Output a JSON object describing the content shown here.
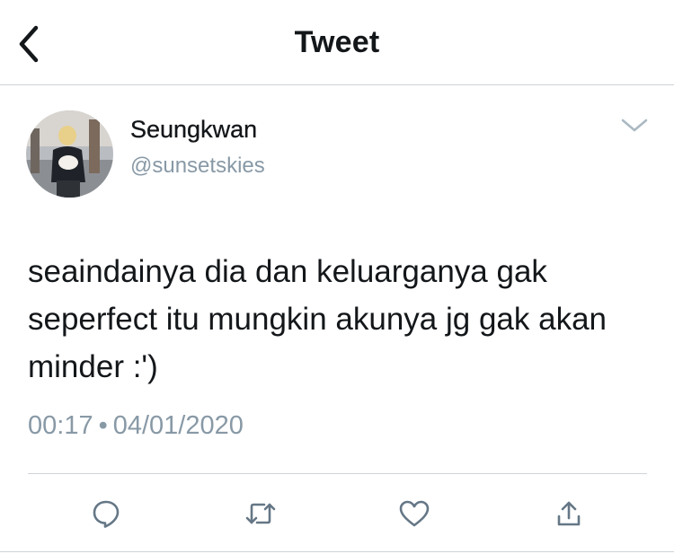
{
  "header": {
    "title": "Tweet",
    "back_icon": "chevron-left-icon"
  },
  "author": {
    "name": "Seungkwan",
    "handle": "@sunsetskies",
    "avatar_icon": "profile-photo"
  },
  "tweet": {
    "text": "seaindainya dia dan keluarganya gak seperfect itu mungkin akunya jg gak akan minder :')",
    "time": "00:17",
    "separator": "•",
    "date": "04/01/2020"
  },
  "actions": [
    "reply-icon",
    "retweet-icon",
    "like-icon",
    "share-icon"
  ],
  "colors": {
    "text_primary": "#14171a",
    "text_secondary": "#8899a6",
    "icon": "#657786",
    "divider": "#cfd3d7"
  }
}
